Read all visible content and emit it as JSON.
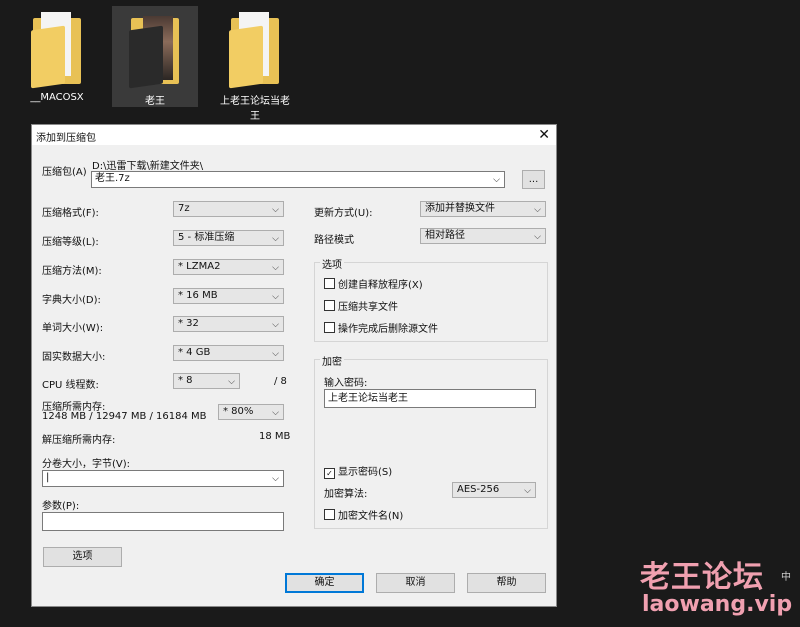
{
  "desktop": {
    "icons": [
      {
        "label": "__MACOSX"
      },
      {
        "label": "老王"
      },
      {
        "label": "上老王论坛当老王"
      }
    ]
  },
  "dialog": {
    "title": "添加到压缩包",
    "archive_label": "压缩包(A)",
    "archive_path": "D:\\迅雷下载\\新建文件夹\\",
    "archive_name": "老王.7z",
    "browse_label": "...",
    "format_label": "压缩格式(F):",
    "format_value": "7z",
    "level_label": "压缩等级(L):",
    "level_value": "5 - 标准压缩",
    "method_label": "压缩方法(M):",
    "method_value": "* LZMA2",
    "dict_label": "字典大小(D):",
    "dict_value": "* 16 MB",
    "word_label": "单词大小(W):",
    "word_value": "* 32",
    "solid_label": "固实数据大小:",
    "solid_value": "* 4 GB",
    "cpu_label": "CPU 线程数:",
    "cpu_value": "* 8",
    "cpu_total": "/ 8",
    "mem_label": "压缩所需内存:",
    "mem_detail": "1248 MB / 12947 MB / 16184 MB",
    "mem_value": "* 80%",
    "decomp_label": "解压缩所需内存:",
    "decomp_value": "18 MB",
    "split_label": "分卷大小，字节(V):",
    "split_value": "|",
    "params_label": "参数(P):",
    "params_value": "",
    "options_button": "选项",
    "update_label": "更新方式(U):",
    "update_value": "添加并替换文件",
    "path_label": "路径模式",
    "path_value": "相对路径",
    "options_group": "选项",
    "opt_sfx": "创建自释放程序(X)",
    "opt_shared": "压缩共享文件",
    "opt_delete": "操作完成后删除源文件",
    "encrypt_group": "加密",
    "password_label": "输入密码:",
    "password_value": "上老王论坛当老王",
    "show_password": "显示密码(S)",
    "enc_method_label": "加密算法:",
    "enc_method_value": "AES-256",
    "enc_names": "加密文件名(N)",
    "ok": "确定",
    "cancel": "取消",
    "help": "帮助"
  },
  "watermark": {
    "line1": "老王论坛",
    "line2": "laowang.vip"
  },
  "side_text": "中"
}
